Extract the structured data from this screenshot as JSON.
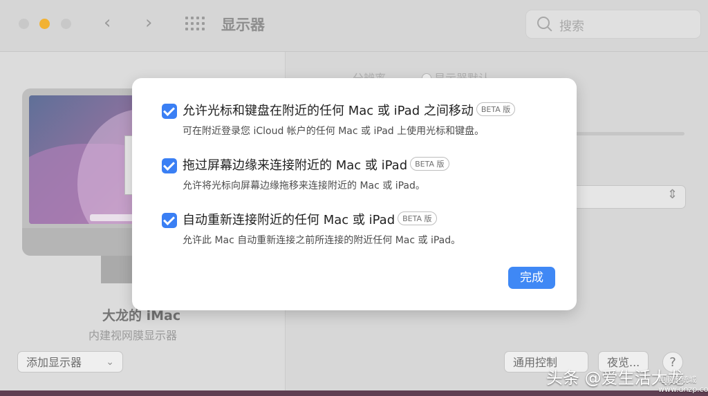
{
  "window": {
    "title": "显示器",
    "search_placeholder": "搜索"
  },
  "left_pane": {
    "display_name": "大龙的 iMac",
    "display_subtitle": "内建视网膜显示器",
    "add_display_label": "添加显示器"
  },
  "right_pane": {
    "resolution_label": "分辨率",
    "resolution_option": "显示器默认",
    "universal_control_label": "通用控制",
    "night_shift_label": "夜览...",
    "help_label": "?"
  },
  "dialog": {
    "options": [
      {
        "title": "允许光标和键盘在附近的任何 Mac 或 iPad 之间移动",
        "badge": "BETA 版",
        "description": "可在附近登录您 iCloud 帐户的任何 Mac 或 iPad 上使用光标和键盘。",
        "checked": true
      },
      {
        "title": "拖过屏幕边缘来连接附近的 Mac 或 iPad",
        "badge": "BETA 版",
        "description": "允许将光标向屏幕边缘拖移来连接附近的 Mac 或 iPad。",
        "checked": true
      },
      {
        "title": "自动重新连接附近的任何 Mac 或 iPad",
        "badge": "BETA 版",
        "description": "允许此 Mac 自动重新连接之前所连接的附近任何 Mac 或 iPad。",
        "checked": true
      }
    ],
    "done_label": "完成"
  },
  "watermark": {
    "text": "头条 @爱生活大龙",
    "site": "电脑系统城 www.dnzp.com"
  },
  "icons": {
    "back": "chevron-left-icon",
    "forward": "chevron-right-icon",
    "grid": "grid-icon",
    "search": "search-icon",
    "checkbox": "checkmark-icon"
  },
  "colors": {
    "accent": "#3f88f5",
    "traffic_minimize": "#f2b232"
  }
}
